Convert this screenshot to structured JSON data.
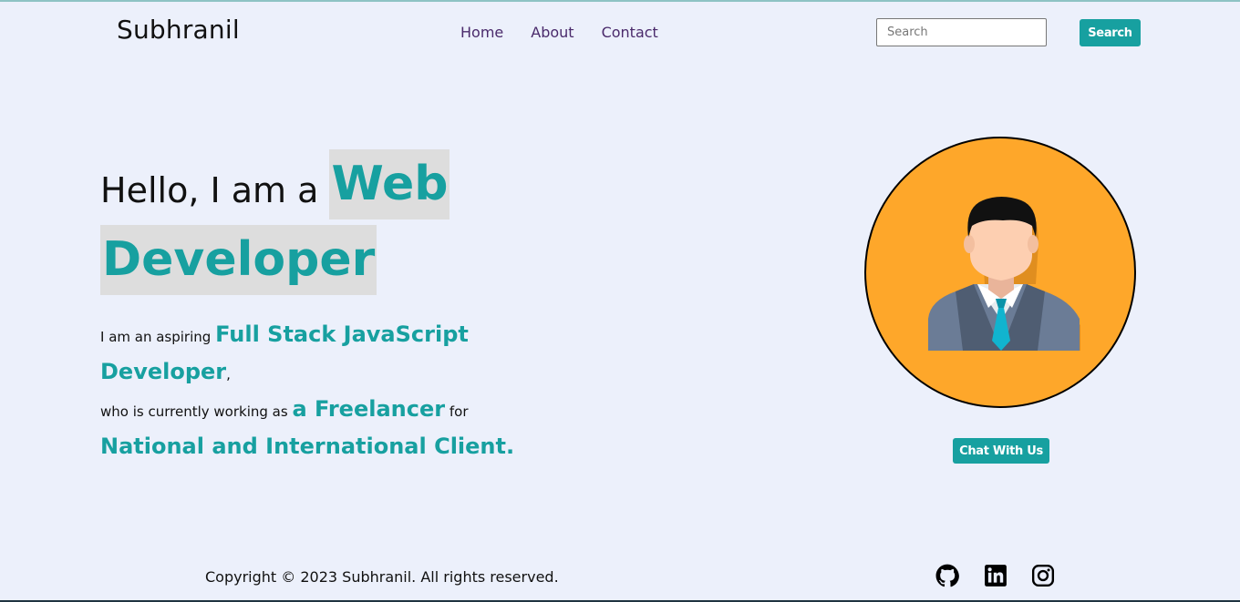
{
  "navbar": {
    "brand": "Subhranil",
    "links": [
      "Home",
      "About",
      "Contact"
    ],
    "search_placeholder": "Search",
    "search_button": "Search"
  },
  "hero": {
    "greeting": "Hello, I am a",
    "role_word1": "Web",
    "role_word2": "Developer",
    "desc_intro": "I am an aspiring ",
    "desc_role": "Full Stack JavaScript Developer",
    "desc_comma": ",",
    "desc_working": "who is currently working as ",
    "desc_freelancer": "a Freelancer",
    "desc_for": " for",
    "desc_clients": "National and International Client."
  },
  "profile": {
    "avatar_icon": "businessman-avatar-icon",
    "chat_button": "Chat With Us"
  },
  "footer": {
    "copyright": "Copyright © 2023 Subhranil. All rights reserved.",
    "social_icons": [
      "github-icon",
      "linkedin-icon",
      "instagram-icon"
    ]
  },
  "colors": {
    "background": "#ecf0fb",
    "accent": "#17a0a0",
    "highlight": "#dddddd",
    "avatar_bg": "#fea72a",
    "nav_link": "#4a2a6b"
  }
}
